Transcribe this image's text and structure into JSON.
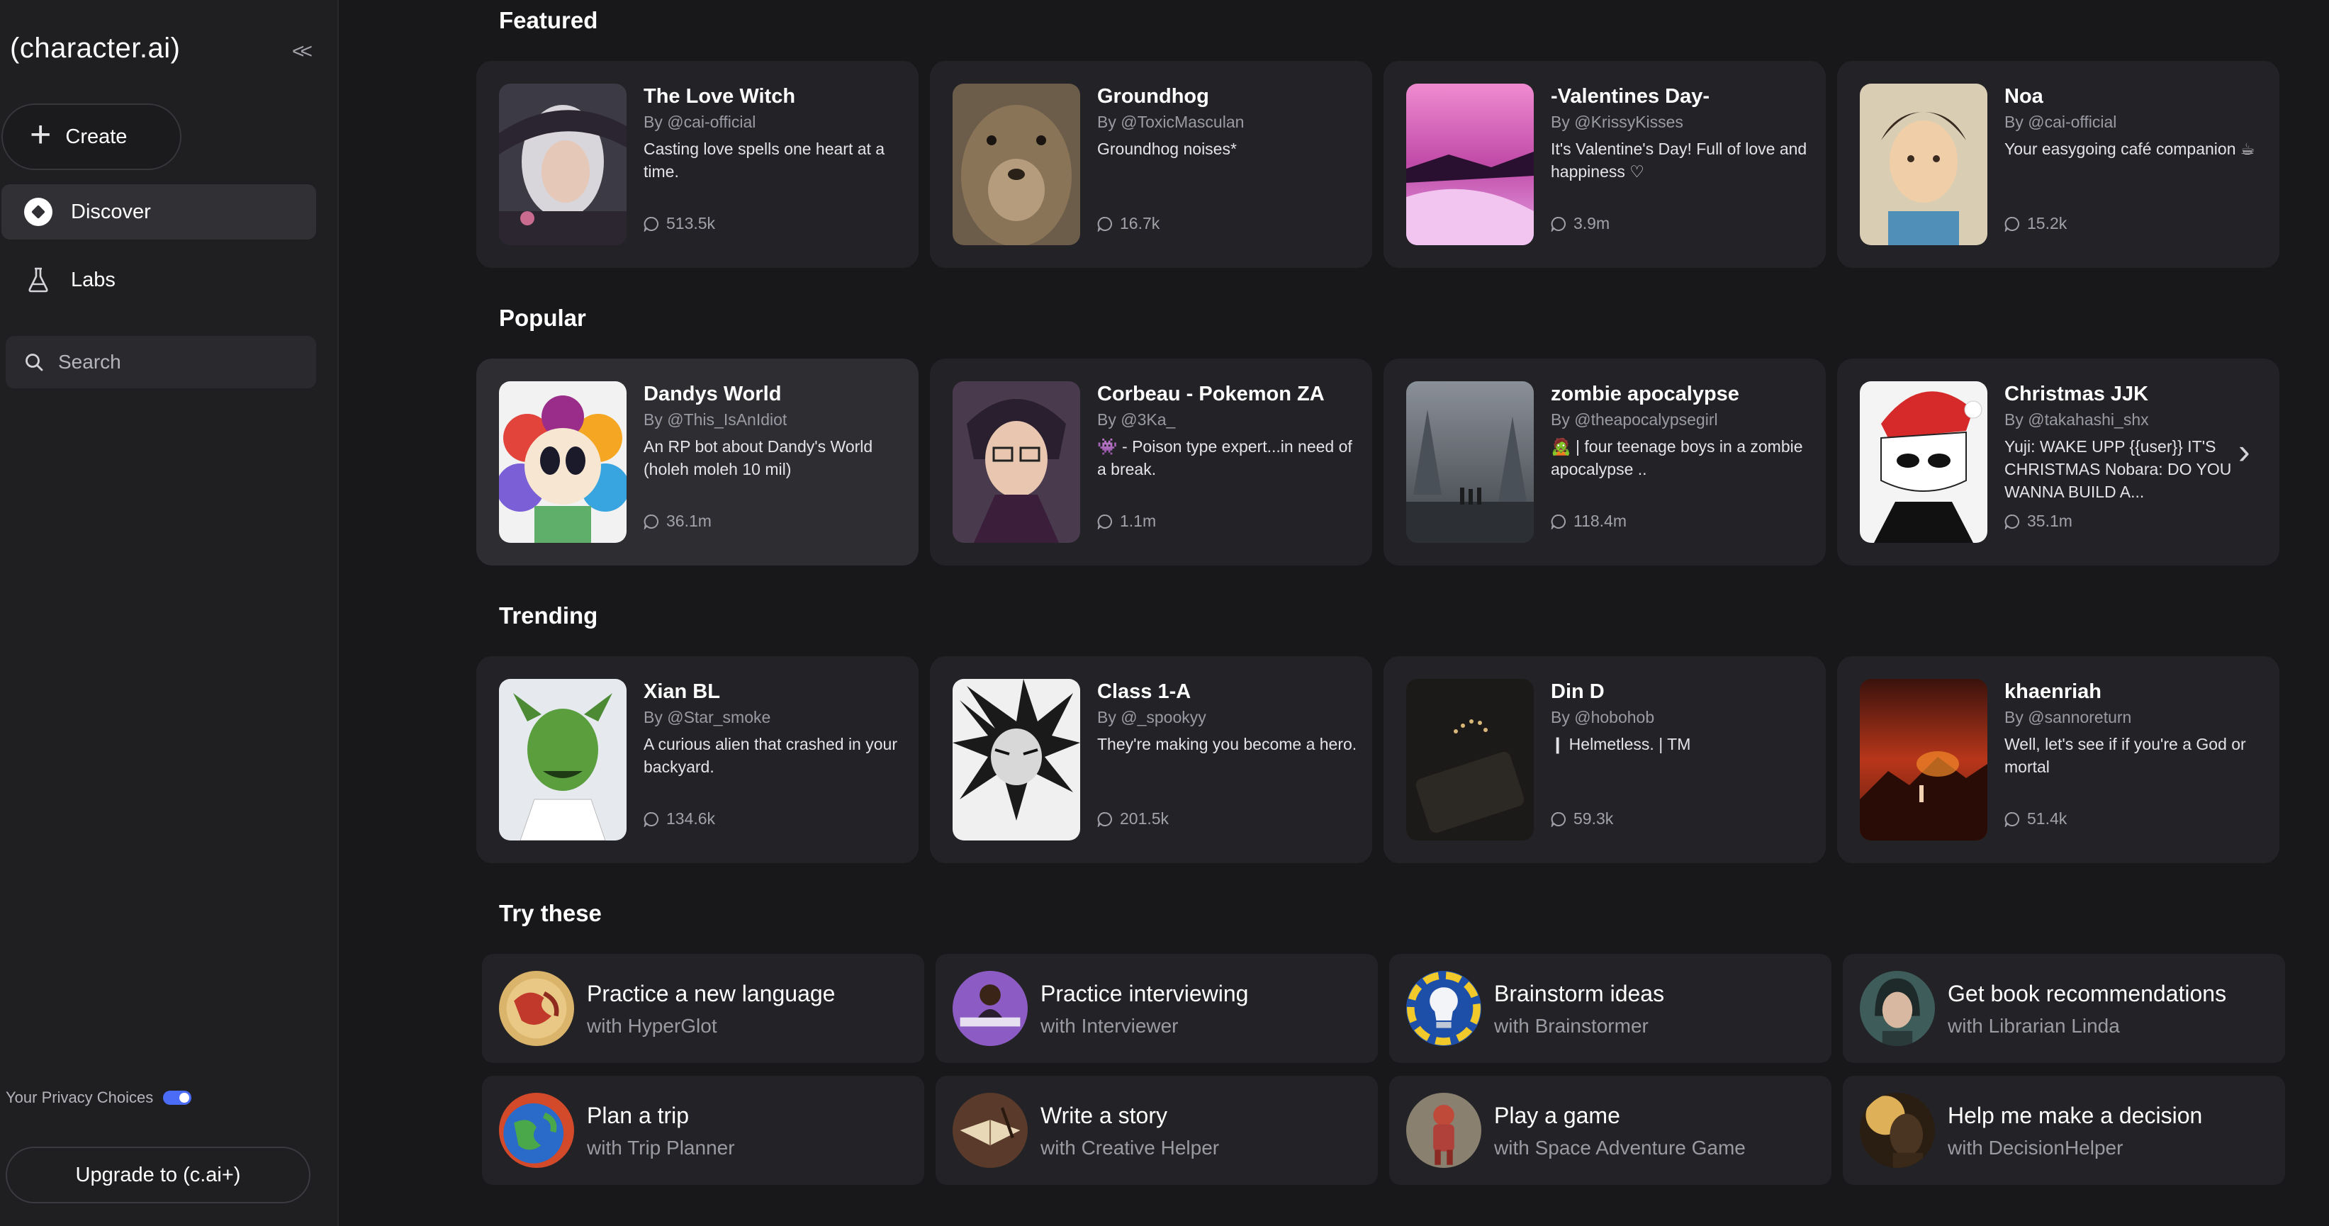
{
  "sidebar": {
    "logo": "(character.ai)",
    "collapse_icon": "double-chevron-left",
    "create_label": "Create",
    "nav": [
      {
        "label": "Discover",
        "icon": "compass-icon",
        "active": true
      },
      {
        "label": "Labs",
        "icon": "flask-icon",
        "active": false
      }
    ],
    "search_label": "Search",
    "privacy_label": "Your Privacy Choices",
    "upgrade_label": "Upgrade to (c.ai+)"
  },
  "sections": {
    "featured": {
      "title": "Featured",
      "cards": [
        {
          "title": "The Love Witch",
          "author": "By @cai-official",
          "desc": "Casting love spells one heart at a time.",
          "count": "513.5k"
        },
        {
          "title": "Groundhog",
          "author": "By @ToxicMasculan",
          "desc": "Groundhog noises*",
          "count": "16.7k"
        },
        {
          "title": "-Valentines Day-",
          "author": "By @KrissyKisses",
          "desc": "It's Valentine's Day! Full of love and happiness ♡",
          "count": "3.9m"
        },
        {
          "title": "Noa",
          "author": "By @cai-official",
          "desc": "Your easygoing café companion ☕",
          "count": "15.2k"
        }
      ]
    },
    "popular": {
      "title": "Popular",
      "cards": [
        {
          "title": "Dandys World",
          "author": "By @This_IsAnIdiot",
          "desc": "An RP bot about Dandy's World (holeh moleh 10 mil)",
          "count": "36.1m"
        },
        {
          "title": "Corbeau - Pokemon ZA",
          "author": "By @3Ka_",
          "desc": "👾 - Poison type expert...in need of a break.",
          "count": "1.1m"
        },
        {
          "title": "zombie apocalypse",
          "author": "By @theapocalypsegirl",
          "desc": "🧟 | four teenage boys in a zombie apocalypse ..",
          "count": "118.4m"
        },
        {
          "title": "Christmas JJK",
          "author": "By @takahashi_shx",
          "desc": "Yuji: WAKE UPP {{user}} IT'S CHRISTMAS Nobara: DO YOU WANNA BUILD A...",
          "count": "35.1m"
        }
      ]
    },
    "trending": {
      "title": "Trending",
      "cards": [
        {
          "title": "Xian BL",
          "author": "By @Star_smoke",
          "desc": "A curious alien that crashed in your backyard.",
          "count": "134.6k"
        },
        {
          "title": "Class 1-A",
          "author": "By @_spookyy",
          "desc": "They're making you become a hero.",
          "count": "201.5k"
        },
        {
          "title": "Din D",
          "author": "By @hobohob",
          "desc": "❙ Helmetless. | TM",
          "count": "59.3k"
        },
        {
          "title": "khaenriah",
          "author": "By @sannoreturn",
          "desc": "Well, let's see if if you're a God or mortal",
          "count": "51.4k"
        }
      ]
    },
    "try": {
      "title": "Try these",
      "items": [
        {
          "title": "Practice a new language",
          "sub": "with HyperGlot"
        },
        {
          "title": "Practice interviewing",
          "sub": "with Interviewer"
        },
        {
          "title": "Brainstorm ideas",
          "sub": "with Brainstormer"
        },
        {
          "title": "Get book recommendations",
          "sub": "with Librarian Linda"
        },
        {
          "title": "Plan a trip",
          "sub": "with Trip Planner"
        },
        {
          "title": "Write a story",
          "sub": "with Creative Helper"
        },
        {
          "title": "Play a game",
          "sub": "with Space Adventure Game"
        },
        {
          "title": "Help me make a decision",
          "sub": "with DecisionHelper"
        }
      ]
    }
  }
}
